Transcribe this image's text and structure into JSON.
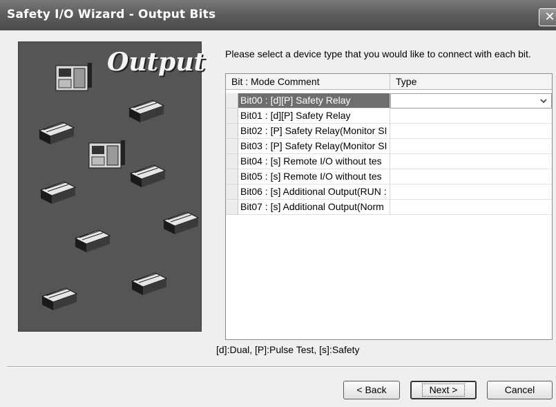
{
  "window": {
    "title": "Safety I/O Wizard - Output Bits",
    "close_symbol": "✕"
  },
  "graphic": {
    "title": "Output"
  },
  "instruction": "Please select a device type that you would like to connect with each bit.",
  "grid": {
    "headers": {
      "bit_mode_comment": "Bit : Mode Comment",
      "type": "Type"
    },
    "rows": [
      {
        "label": "Bit00 : [d][P] Safety Relay",
        "type": "",
        "selected": true
      },
      {
        "label": "Bit01 : [d][P] Safety Relay",
        "type": ""
      },
      {
        "label": "Bit02 : [P] Safety Relay(Monitor SI",
        "type": ""
      },
      {
        "label": "Bit03 : [P] Safety Relay(Monitor SI",
        "type": ""
      },
      {
        "label": "Bit04 : [s] Remote I/O without tes",
        "type": ""
      },
      {
        "label": "Bit05 : [s] Remote I/O without tes",
        "type": ""
      },
      {
        "label": "Bit06 : [s] Additional Output(RUN :",
        "type": ""
      },
      {
        "label": "Bit07 : [s] Additional Output(Norm",
        "type": ""
      }
    ]
  },
  "legend": "[d]:Dual, [P]:Pulse Test, [s]:Safety",
  "buttons": {
    "back": "< Back",
    "next": "Next >",
    "cancel": "Cancel"
  }
}
